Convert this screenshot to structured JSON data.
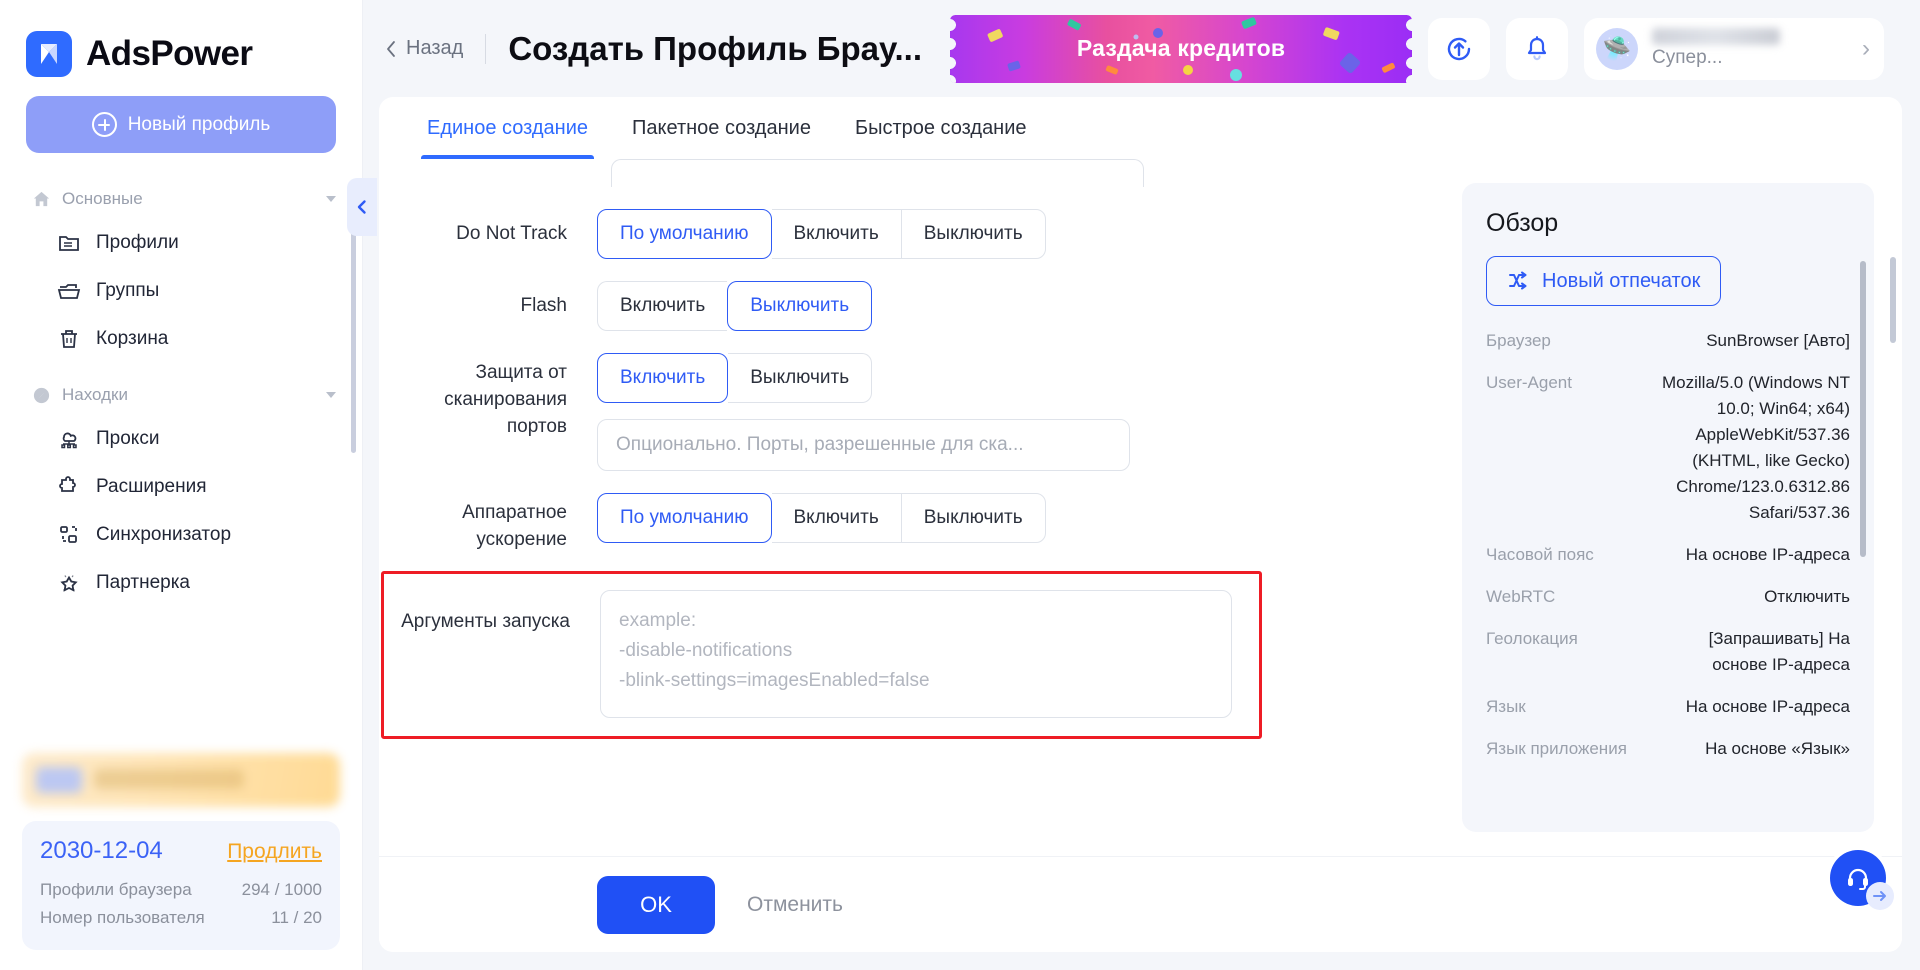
{
  "brand": {
    "name": "AdsPower",
    "logo_icon": "adspower-logo-icon",
    "accent": "#2f6bff"
  },
  "sidebar": {
    "new_profile_label": "Новый профиль",
    "groups": [
      {
        "label": "Основные",
        "icon": "home-icon",
        "items": [
          {
            "label": "Профили",
            "icon": "folder-list-icon"
          },
          {
            "label": "Группы",
            "icon": "folder-open-icon"
          },
          {
            "label": "Корзина",
            "icon": "trash-icon"
          }
        ]
      },
      {
        "label": "Находки",
        "icon": "compass-icon",
        "items": [
          {
            "label": "Прокси",
            "icon": "proxy-cloud-icon"
          },
          {
            "label": "Расширения",
            "icon": "puzzle-icon"
          },
          {
            "label": "Синхронизатор",
            "icon": "sync-grid-icon"
          },
          {
            "label": "Партнерка",
            "icon": "star-icon"
          }
        ]
      }
    ],
    "subscription": {
      "date": "2030-12-04",
      "renew_label": "Продлить",
      "rows": [
        {
          "key": "Профили браузера",
          "value": "294 / 1000"
        },
        {
          "key": "Номер пользователя",
          "value": "11 / 20"
        }
      ]
    },
    "collapse_icon": "chevron-left-icon"
  },
  "topbar": {
    "back_label": "Назад",
    "back_icon": "chevron-left-icon",
    "title": "Создать Профиль Брау...",
    "promo_label": "Раздача кредитов",
    "update_icon": "update-circle-icon",
    "bell_icon": "bell-icon",
    "avatar_icon": "ufo-avatar-icon",
    "user_plan": "Супер...",
    "user_chevron_icon": "chevron-right-icon"
  },
  "tabs": [
    {
      "label": "Единое создание",
      "active": true
    },
    {
      "label": "Пакетное создание",
      "active": false
    },
    {
      "label": "Быстрое создание",
      "active": false
    }
  ],
  "form": {
    "do_not_track": {
      "label": "Do Not Track",
      "options": [
        "По умолчанию",
        "Включить",
        "Выключить"
      ],
      "selected": "По умолчанию"
    },
    "flash": {
      "label": "Flash",
      "options": [
        "Включить",
        "Выключить"
      ],
      "selected": "Выключить"
    },
    "port_scan": {
      "label": "Защита от сканирования портов",
      "options": [
        "Включить",
        "Выключить"
      ],
      "selected": "Включить",
      "input_placeholder": "Опционально. Порты, разрешенные для ска..."
    },
    "hardware_accel": {
      "label": "Аппаратное ускорение",
      "options": [
        "По умолчанию",
        "Включить",
        "Выключить"
      ],
      "selected": "По умолчанию"
    },
    "launch_args": {
      "label": "Аргументы запуска",
      "placeholder": "example:\n-disable-notifications\n-blink-settings=imagesEnabled=false",
      "highlight_color": "#ee1c25"
    }
  },
  "overview": {
    "title": "Обзор",
    "fingerprint_button": "Новый отпечаток",
    "fingerprint_icon": "shuffle-icon",
    "rows": [
      {
        "key": "Браузер",
        "value": "SunBrowser [Авто]"
      },
      {
        "key": "User-Agent",
        "value": "Mozilla/5.0 (Windows NT 10.0; Win64; x64) AppleWebKit/537.36 (KHTML, like Gecko) Chrome/123.0.6312.86 Safari/537.36"
      },
      {
        "key": "Часовой пояс",
        "value": "На основе IP-адреса"
      },
      {
        "key": "WebRTC",
        "value": "Отключить"
      },
      {
        "key": "Геолокация",
        "value": "[Запрашивать] На основе IP-адреса"
      },
      {
        "key": "Язык",
        "value": "На основе IP-адреса"
      },
      {
        "key": "Язык приложения",
        "value": "На основе «Язык»"
      }
    ]
  },
  "footer": {
    "ok_label": "OK",
    "cancel_label": "Отменить"
  },
  "support": {
    "icon": "headset-icon",
    "badge_icon": "arrow-right-icon"
  }
}
